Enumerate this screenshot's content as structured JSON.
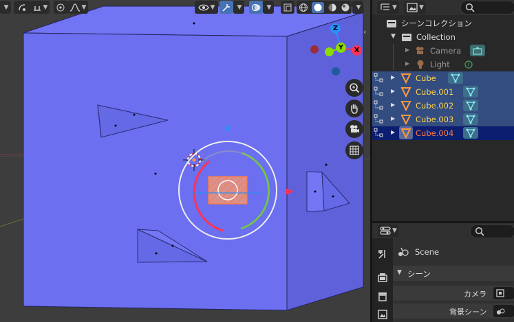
{
  "outliner": {
    "scene_collection_label": "シーンコレクション",
    "collection_label": "Collection",
    "items": [
      {
        "label": "Camera",
        "color": "#9a9a9a"
      },
      {
        "label": "Light",
        "color": "#9a9a9a"
      },
      {
        "label": "Cube",
        "color": "#ffd34d"
      },
      {
        "label": "Cube.001",
        "color": "#ffd34d"
      },
      {
        "label": "Cube.002",
        "color": "#ffd34d"
      },
      {
        "label": "Cube.003",
        "color": "#ffd34d"
      },
      {
        "label": "Cube.004",
        "color": "#ff7a3d"
      }
    ]
  },
  "properties": {
    "scene_label": "Scene",
    "section_label": "シーン",
    "camera_label": "カメラ",
    "background_scene_label": "背景シーン"
  },
  "gizmo": {
    "z_label": "Z",
    "y_label": "Y",
    "x_label": "X"
  },
  "colors": {
    "cube_face": "#6b6ff0",
    "cube_top": "#7174f3",
    "cube_side": "#5e61d9",
    "selected_row": "#334d80",
    "active_row": "#0c1e70",
    "accent": "#4772b3",
    "x_axis": "#ff3352",
    "y_axis": "#8bdc00",
    "z_axis": "#2890ff"
  }
}
